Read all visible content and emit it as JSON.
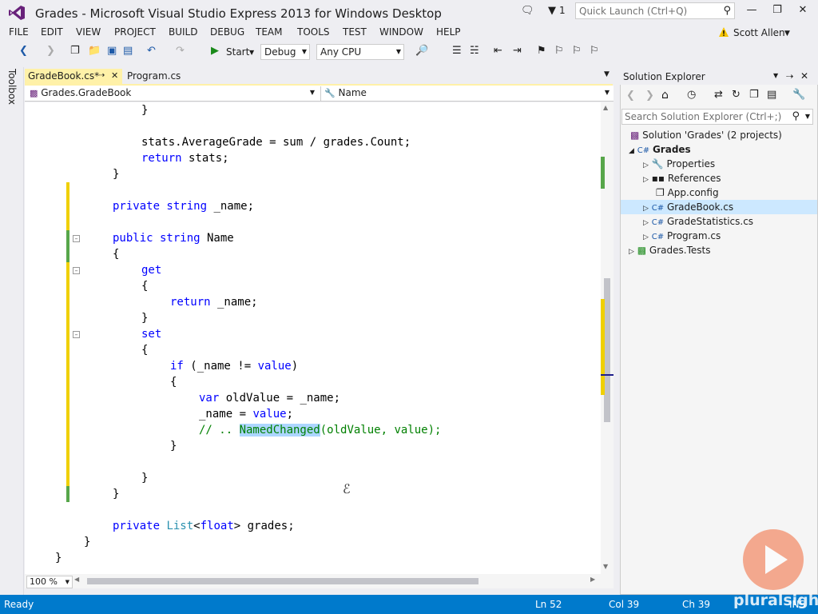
{
  "window": {
    "title": "Grades - Microsoft Visual Studio Express 2013 for Windows Desktop",
    "notif_count": "1",
    "quick_launch": "Quick Launch (Ctrl+Q)"
  },
  "menu": [
    "FILE",
    "EDIT",
    "VIEW",
    "PROJECT",
    "BUILD",
    "DEBUG",
    "TEAM",
    "TOOLS",
    "TEST",
    "WINDOW",
    "HELP"
  ],
  "user": "Scott Allen",
  "toolbar": {
    "start": "Start",
    "config": "Debug",
    "platform": "Any CPU"
  },
  "toolbox": "Toolbox",
  "tabs": {
    "active": "GradeBook.cs*",
    "other": "Program.cs"
  },
  "nav": {
    "left": "Grades.GradeBook",
    "right": "Name"
  },
  "code": {
    "l1": "}",
    "l2a": "stats.AverageGrade = sum / grades.Count;",
    "l3a": "return",
    "l3b": " stats;",
    "l4": "}",
    "l5a": "private string",
    "l5b": " _name;",
    "l6a": "public string",
    "l6b": " Name",
    "l7": "{",
    "l8": "get",
    "l9": "{",
    "l10a": "return",
    "l10b": " _name;",
    "l11": "}",
    "l12": "set",
    "l13": "{",
    "l14a": "if",
    "l14b": " (_name != ",
    "l14c": "value",
    "l14d": ")",
    "l15": "{",
    "l16a": "var",
    "l16b": " oldValue = _name;",
    "l17a": "_name = ",
    "l17b": "value",
    "l17c": ";",
    "l18a": "// .. ",
    "l18b": "NamedChanged",
    "l18c": "(oldValue, value);",
    "l19": "}",
    "l20": "}",
    "l21": "}",
    "l22a": "private",
    "l22b": "List",
    "l22c": "<",
    "l22d": "float",
    "l22e": "> grades;",
    "l23": "}",
    "l24": "}"
  },
  "zoom": "100 %",
  "solution": {
    "title": "Solution Explorer",
    "search": "Search Solution Explorer (Ctrl+;)",
    "items": [
      "Solution 'Grades' (2 projects)",
      "Grades",
      "Properties",
      "References",
      "App.config",
      "GradeBook.cs",
      "GradeStatistics.cs",
      "Program.cs",
      "Grades.Tests"
    ]
  },
  "status": {
    "ready": "Ready",
    "ln": "Ln 52",
    "col": "Col 39",
    "ch": "Ch 39",
    "ins": "INS"
  },
  "watermark": "pluralsight"
}
